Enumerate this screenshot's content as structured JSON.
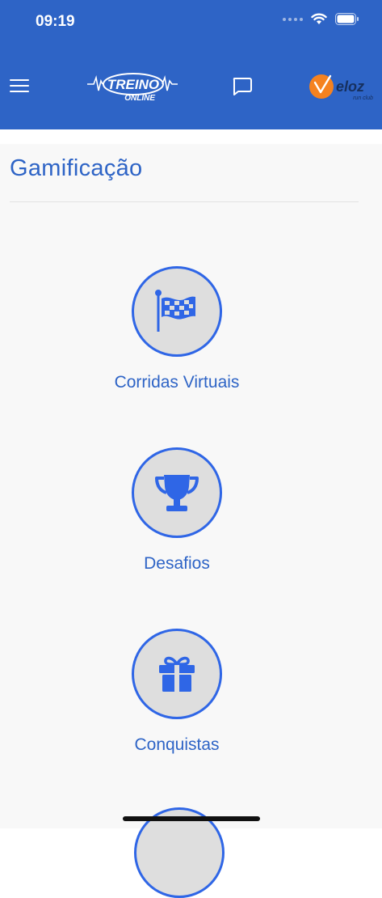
{
  "status_bar": {
    "time": "09:19"
  },
  "header": {
    "logo_left": {
      "line1": "TREINO",
      "line2": "ONLINE"
    },
    "logo_right": {
      "name": "eloz",
      "sub": "run club"
    }
  },
  "page": {
    "title": "Gamificação"
  },
  "items": [
    {
      "label": "Corridas Virtuais",
      "icon": "checkered-flag-icon"
    },
    {
      "label": "Desafios",
      "icon": "trophy-icon"
    },
    {
      "label": "Conquistas",
      "icon": "gift-icon"
    }
  ],
  "colors": {
    "header": "#2e64c6",
    "accent": "#2f66e6",
    "circle_fill": "#dedede",
    "background": "#f8f8f8"
  }
}
